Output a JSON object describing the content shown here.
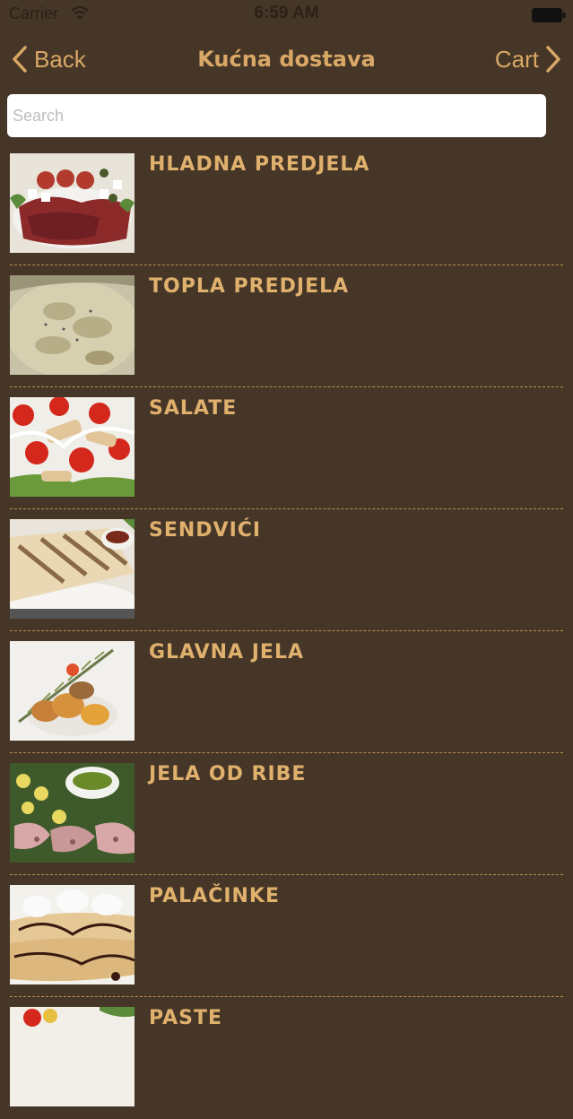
{
  "status_bar": {
    "carrier": "Carrier",
    "time": "6:59 AM"
  },
  "nav": {
    "back_label": "Back",
    "title": "Kućna dostava",
    "cart_label": "Cart"
  },
  "search": {
    "placeholder": "Search",
    "value": ""
  },
  "menu": {
    "items": [
      {
        "label": "HLADNA PREDJELA",
        "image": "cold-appetizers-photo"
      },
      {
        "label": "TOPLA PREDJELA",
        "image": "warm-appetizers-photo"
      },
      {
        "label": "SALATE",
        "image": "salads-photo"
      },
      {
        "label": "SENDVIĆI",
        "image": "sandwiches-photo"
      },
      {
        "label": "GLAVNA JELA",
        "image": "main-dishes-photo"
      },
      {
        "label": "JELA OD RIBE",
        "image": "fish-dishes-photo"
      },
      {
        "label": "PALAČINKE",
        "image": "pancakes-photo"
      },
      {
        "label": "PASTE",
        "image": "pasta-photo"
      }
    ]
  },
  "colors": {
    "background": "#463627",
    "accent": "#d9a866",
    "divider": "#b9904f"
  }
}
